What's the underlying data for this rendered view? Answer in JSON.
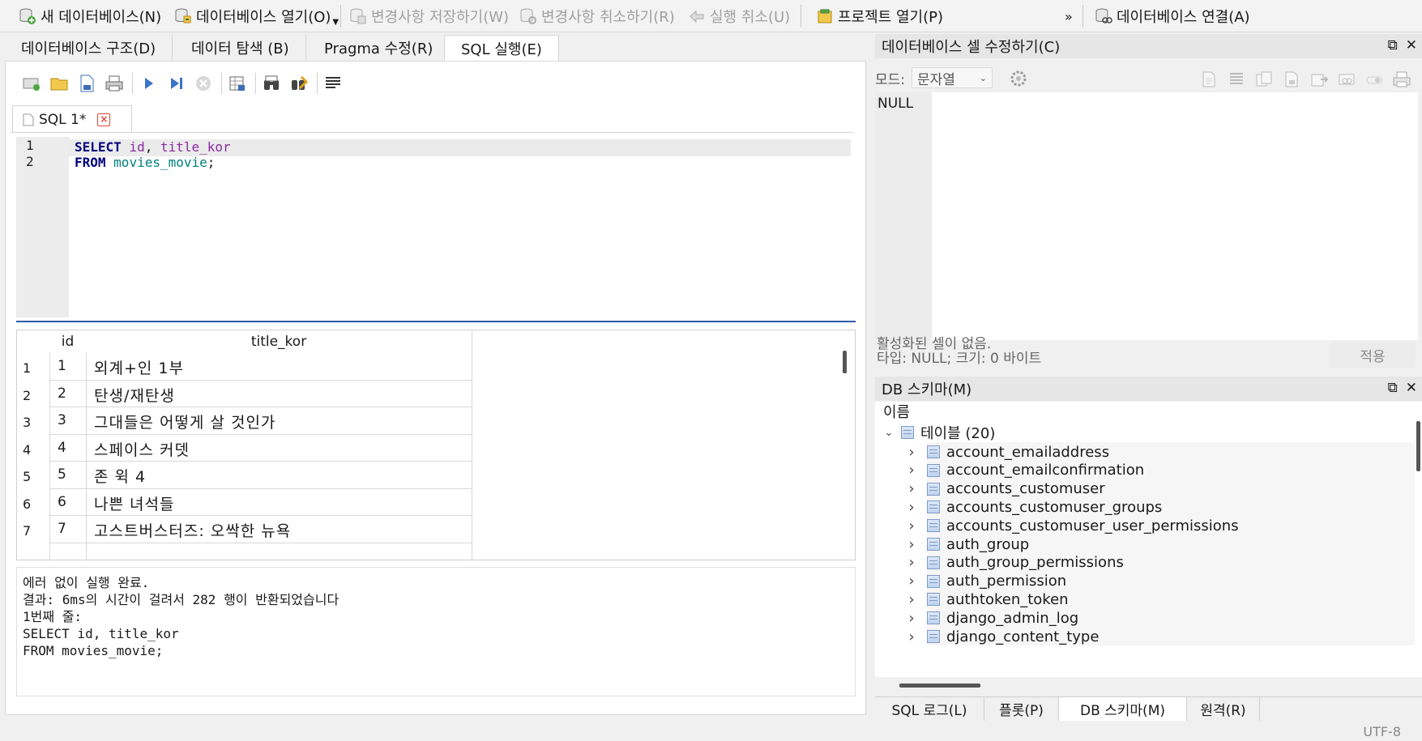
{
  "toolbar": {
    "new_db": "새 데이터베이스(N)",
    "open_db": "데이터베이스 열기(O)",
    "write_changes": "변경사항 저장하기(W)",
    "revert_changes": "변경사항 취소하기(R)",
    "undo": "실행 취소(U)",
    "open_project": "프로젝트 열기(P)",
    "overflow": "»",
    "attach_db": "데이터베이스 연결(A)"
  },
  "tabs": [
    "데이터베이스 구조(D)",
    "데이터 탐색 (B)",
    "Pragma 수정(R)",
    "SQL 실행(E)"
  ],
  "active_tab": 3,
  "editor_tab": {
    "label": "SQL 1*",
    "close": "×"
  },
  "editor": {
    "line_numbers": [
      "1",
      "2"
    ],
    "line1": {
      "kw": "SELECT",
      "rest_a": "id",
      "comma": ", ",
      "rest_b": "title_kor"
    },
    "line2": {
      "kw": "FROM",
      "table": "movies_movie",
      "semi": ";"
    }
  },
  "grid": {
    "columns": [
      "id",
      "title_kor"
    ],
    "rows": [
      {
        "n": "1",
        "id": "1",
        "title": "외계+인 1부"
      },
      {
        "n": "2",
        "id": "2",
        "title": "탄생/재탄생"
      },
      {
        "n": "3",
        "id": "3",
        "title": "그대들은 어떻게 살 것인가"
      },
      {
        "n": "4",
        "id": "4",
        "title": "스페이스 커뎃"
      },
      {
        "n": "5",
        "id": "5",
        "title": "존 윅 4"
      },
      {
        "n": "6",
        "id": "6",
        "title": "나쁜 녀석들"
      },
      {
        "n": "7",
        "id": "7",
        "title": "고스트버스터즈: 오싹한 뉴욕"
      }
    ]
  },
  "message": {
    "line1": "에러 없이 실행 완료.",
    "line2": "결과: 6ms의 시간이 걸려서 282 행이 반환되었습니다",
    "line3": "1번째 줄:",
    "line4": "SELECT id, title_kor",
    "line5": "FROM movies_movie;"
  },
  "cell_editor": {
    "title": "데이터베이스 셀 수정하기(C)",
    "mode_label": "모드:",
    "mode_value": "문자열",
    "value": "NULL",
    "status1": "활성화된 셀이 없음.",
    "status2": "타입: NULL; 크기: 0 바이트",
    "apply": "적용"
  },
  "schema": {
    "title": "DB 스키마(M)",
    "header": "이름",
    "tables_node": "테이블 (20)",
    "tables": [
      "account_emailaddress",
      "account_emailconfirmation",
      "accounts_customuser",
      "accounts_customuser_groups",
      "accounts_customuser_user_permissions",
      "auth_group",
      "auth_group_permissions",
      "auth_permission",
      "authtoken_token",
      "django_admin_log",
      "django_content_type"
    ]
  },
  "dock_tabs": [
    "SQL 로그(L)",
    "플롯(P)",
    "DB 스키마(M)",
    "원격(R)"
  ],
  "dock_active": 2,
  "status": {
    "encoding": "UTF-8"
  },
  "colors": {
    "keyword": "#000080",
    "column": "#8b2ba0",
    "table": "#008080",
    "splitter": "#2c5ba5"
  }
}
